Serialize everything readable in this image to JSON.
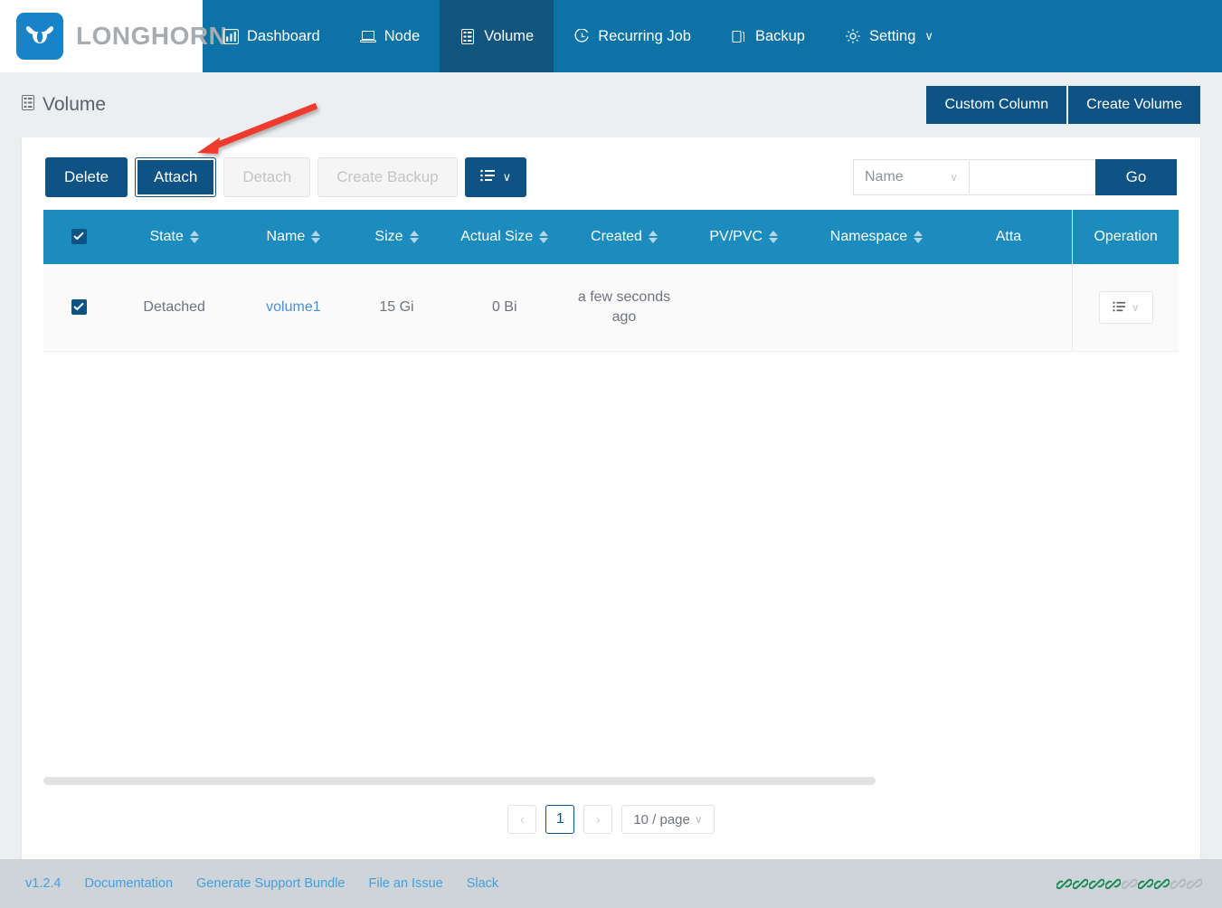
{
  "navbar": {
    "brand": "LONGHORN",
    "brand_icon": "longhorn-bull-icon",
    "items": [
      {
        "label": "Dashboard",
        "icon": "chart-bar-icon",
        "active": false
      },
      {
        "label": "Node",
        "icon": "server-node-icon",
        "active": false
      },
      {
        "label": "Volume",
        "icon": "database-volume-icon",
        "active": true
      },
      {
        "label": "Recurring Job",
        "icon": "clock-icon",
        "active": false
      },
      {
        "label": "Backup",
        "icon": "copy-backup-icon",
        "active": false
      },
      {
        "label": "Setting",
        "icon": "gear-icon",
        "active": false,
        "caret": "∨"
      }
    ]
  },
  "page": {
    "title": "Volume",
    "title_icon": "database-volume-icon",
    "custom_column_label": "Custom Column",
    "create_volume_label": "Create Volume"
  },
  "toolbar": {
    "delete_label": "Delete",
    "attach_label": "Attach",
    "detach_label": "Detach",
    "create_backup_label": "Create Backup",
    "more_icon": "list-menu-icon",
    "more_caret": "∨",
    "search_field_label": "Name",
    "search_field_caret": "∨",
    "search_value": "",
    "search_placeholder": "",
    "go_label": "Go"
  },
  "table": {
    "header_checkbox_checked": true,
    "columns": [
      {
        "key": "check",
        "label": "",
        "sortable": false
      },
      {
        "key": "state",
        "label": "State",
        "sortable": true
      },
      {
        "key": "name",
        "label": "Name",
        "sortable": true
      },
      {
        "key": "size",
        "label": "Size",
        "sortable": true
      },
      {
        "key": "actual_size",
        "label": "Actual Size",
        "sortable": true
      },
      {
        "key": "created",
        "label": "Created",
        "sortable": true
      },
      {
        "key": "pvpvc",
        "label": "PV/PVC",
        "sortable": true
      },
      {
        "key": "namespace",
        "label": "Namespace",
        "sortable": true
      },
      {
        "key": "attached",
        "label": "Atta",
        "sortable": false
      },
      {
        "key": "operation",
        "label": "Operation",
        "sortable": false
      }
    ],
    "rows": [
      {
        "checked": true,
        "state": "Detached",
        "name": "volume1",
        "size": "15 Gi",
        "actual_size": "0 Bi",
        "created": "a few seconds ago",
        "pvpvc": "",
        "namespace": "",
        "attached": "",
        "operation_icon": "list-menu-icon",
        "operation_caret": "∨"
      }
    ]
  },
  "pagination": {
    "prev": "‹",
    "current_page": "1",
    "next": "›",
    "page_size": "10 / page",
    "page_size_caret": "∨"
  },
  "footer": {
    "version": "v1.2.4",
    "links": [
      "Documentation",
      "Generate Support Bundle",
      "File an Issue",
      "Slack"
    ],
    "status_icons": [
      {
        "name": "link-icon",
        "state": "active"
      },
      {
        "name": "link-icon",
        "state": "active"
      },
      {
        "name": "link-icon",
        "state": "active"
      },
      {
        "name": "link-icon",
        "state": "active"
      },
      {
        "name": "link-icon",
        "state": "inactive"
      },
      {
        "name": "link-icon",
        "state": "active"
      },
      {
        "name": "link-icon",
        "state": "active"
      },
      {
        "name": "link-icon",
        "state": "inactive"
      },
      {
        "name": "link-icon",
        "state": "inactive"
      }
    ]
  },
  "colors": {
    "navbar_blue": "#0d73a6",
    "navbar_active_blue": "#11557f",
    "primary_blue": "#0e5383",
    "table_header_blue": "#1b8cbd",
    "link_blue": "#4a90d9",
    "footer_bg": "#cfd4d8",
    "footer_link": "#41a0e0",
    "annotation_red": "#ee3b2e",
    "icon_active_green": "#1e8c5a",
    "icon_inactive_gray": "#b3b8bc"
  },
  "annotation": {
    "type": "arrow",
    "color": "#ee3b2e",
    "points_to": "attach-button"
  }
}
